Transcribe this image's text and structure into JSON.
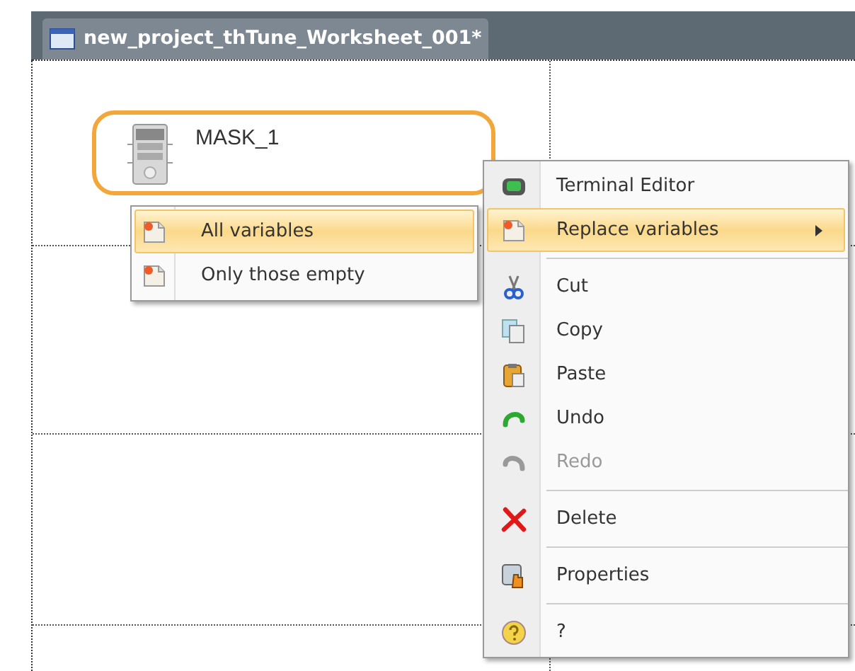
{
  "tab": {
    "title": "new_project_thTune_Worksheet_001*",
    "selected": true
  },
  "node": {
    "label": "MASK_1",
    "selected": true
  },
  "context_menu": {
    "items": [
      {
        "kind": "item",
        "label": "Terminal Editor",
        "selected": false,
        "disabled": false
      },
      {
        "kind": "submenu",
        "label": "Replace variables",
        "selected": true,
        "disabled": false
      },
      {
        "kind": "separator"
      },
      {
        "kind": "item",
        "label": "Cut",
        "selected": false,
        "disabled": false
      },
      {
        "kind": "item",
        "label": "Copy",
        "selected": false,
        "disabled": false
      },
      {
        "kind": "item",
        "label": "Paste",
        "selected": false,
        "disabled": false
      },
      {
        "kind": "item",
        "label": "Undo",
        "selected": false,
        "disabled": false
      },
      {
        "kind": "item",
        "label": "Redo",
        "selected": false,
        "disabled": true
      },
      {
        "kind": "separator"
      },
      {
        "kind": "item",
        "label": "Delete",
        "selected": false,
        "disabled": false
      },
      {
        "kind": "separator"
      },
      {
        "kind": "item",
        "label": "Properties",
        "selected": false,
        "disabled": false
      },
      {
        "kind": "separator"
      },
      {
        "kind": "item",
        "label": "?",
        "selected": false,
        "disabled": false
      }
    ]
  },
  "submenu": {
    "items": [
      {
        "label": "All variables",
        "selected": true
      },
      {
        "label": "Only those empty",
        "selected": false
      }
    ]
  }
}
